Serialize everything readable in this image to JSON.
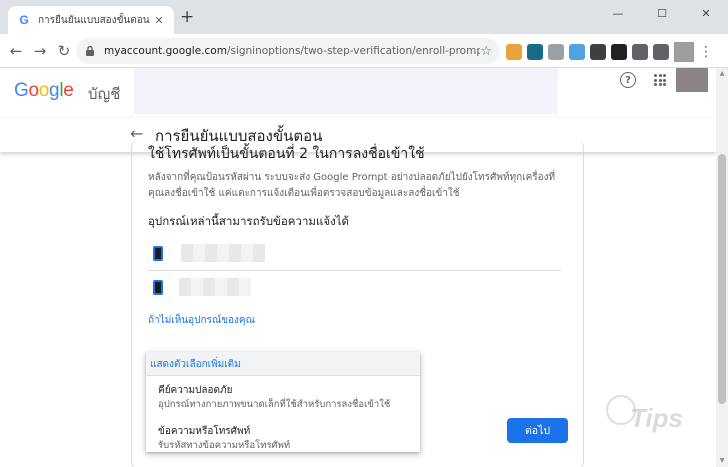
{
  "browser": {
    "tab_title": "การยืนยันแบบสองขั้นตอน",
    "tab_favicon": "G",
    "close_glyph": "✕",
    "new_tab_glyph": "+",
    "window_controls": [
      "—",
      "☐",
      "✕"
    ],
    "url_host": "myaccount.google.com",
    "url_path": "/signinoptions/two-step-verification/enroll-prompt?rapt=AEjH...",
    "icons": {
      "back": "arrow-left-icon",
      "forward": "arrow-right-icon",
      "reload": "reload-icon",
      "lock": "lock-icon",
      "star": "star-icon",
      "menu": "more-vert-icon"
    },
    "glyphs": {
      "back": "←",
      "forward": "→",
      "reload": "↻",
      "lock": "🔒",
      "star": "☆",
      "menu": "⋮"
    },
    "extensions": [
      {
        "name": "extension-1-icon",
        "color": "#e8a33a",
        "glyph": ""
      },
      {
        "name": "extension-2-icon",
        "color": "#1a6b8a",
        "glyph": ""
      },
      {
        "name": "extension-3-icon",
        "color": "#9aa0a6",
        "glyph": ""
      },
      {
        "name": "extension-4-icon",
        "color": "#4fa3e0",
        "glyph": ""
      },
      {
        "name": "extension-5-icon",
        "color": "#3c4043",
        "glyph": ""
      },
      {
        "name": "extension-6-icon",
        "color": "#202124",
        "glyph": ""
      },
      {
        "name": "extension-7-icon",
        "color": "#5f6368",
        "glyph": ""
      },
      {
        "name": "extensions-puzzle-icon",
        "color": "#5f6368",
        "glyph": ""
      }
    ]
  },
  "header": {
    "logo_letters": [
      {
        "ch": "G",
        "color": "#4285f4"
      },
      {
        "ch": "o",
        "color": "#ea4335"
      },
      {
        "ch": "o",
        "color": "#fbbc05"
      },
      {
        "ch": "g",
        "color": "#4285f4"
      },
      {
        "ch": "l",
        "color": "#34a853"
      },
      {
        "ch": "e",
        "color": "#ea4335"
      }
    ],
    "product": "บัญชี",
    "help_glyph": "?"
  },
  "subheader": {
    "back_glyph": "←",
    "title": "การยืนยันแบบสองขั้นตอน"
  },
  "main": {
    "title": "ใช้โทรศัพท์เป็นขั้นตอนที่ 2 ในการลงชื่อเข้าใช้",
    "description": "หลังจากที่คุณป้อนรหัสผ่าน ระบบจะส่ง Google Prompt อย่างปลอดภัยไปยังโทรศัพท์ทุกเครื่องที่คุณลงชื่อเข้าใช้ แค่แตะการแจ้งเตือนเพื่อตรวจสอบข้อมูลและลงชื่อเข้าใช้",
    "devices_heading": "อุปกรณ์เหล่านี้สามารถรับข้อความแจ้งได้",
    "help_link": "ถ้าไม่เห็นอุปกรณ์ของคุณ",
    "next_button": "ต่อไป"
  },
  "dropdown": {
    "header": "แสดงตัวเลือกเพิ่มเติม",
    "options": [
      {
        "title": "คีย์ความปลอดภัย",
        "desc": "อุปกรณ์ทางกายภาพขนาดเล็กที่ใช้สำหรับการลงชื่อเข้าใช้"
      },
      {
        "title": "ข้อความหรือโทรศัพท์",
        "desc": "รับรหัสทางข้อความหรือโทรศัพท์"
      }
    ]
  },
  "watermark": {
    "text": "Tips"
  },
  "colors": {
    "accent": "#1a73e8",
    "chrome_bg": "#dee1e6"
  }
}
